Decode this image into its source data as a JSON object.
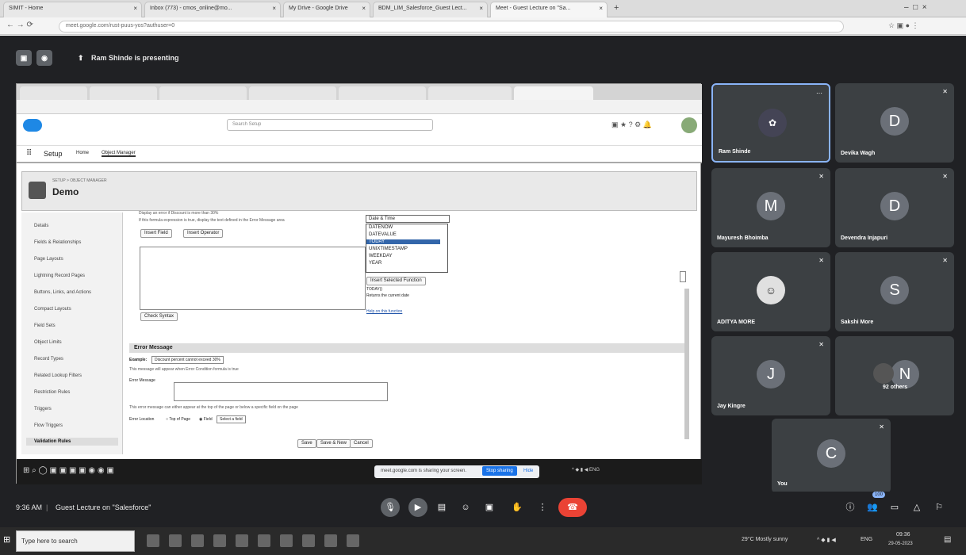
{
  "browser": {
    "tabs": [
      {
        "label": "SIMIT - Home",
        "active": false
      },
      {
        "label": "Inbox (773) - cmos_online@mo...",
        "active": false
      },
      {
        "label": "My Drive - Google Drive",
        "active": false
      },
      {
        "label": "BDM_LIM_Salesforce_Guest Lect...",
        "active": false
      },
      {
        "label": "Meet - Guest Lecture on \"Sa...",
        "active": true
      }
    ],
    "url": "meet.google.com/rust-puus-yos?authuser=0"
  },
  "meet": {
    "presenting_text": "Ram Shinde is presenting",
    "meeting_time": "9:36 AM",
    "meeting_title": "Guest Lecture on \"Salesforce\"",
    "participants": [
      {
        "name": "Ram Shinde",
        "initial": "",
        "color": "#5f6368"
      },
      {
        "name": "Devika Wagh",
        "initial": "D",
        "color": "#6b7078"
      },
      {
        "name": "Mayuresh Bhoimba",
        "initial": "M",
        "color": "#6b7078"
      },
      {
        "name": "Devendra Injapuri",
        "initial": "D",
        "color": "#6b7078"
      },
      {
        "name": "ADITYA MORE",
        "initial": "",
        "color": "#5f6368"
      },
      {
        "name": "Sakshi More",
        "initial": "S",
        "color": "#6b7078"
      },
      {
        "name": "Jay Kingre",
        "initial": "J",
        "color": "#6b7078"
      },
      {
        "name": "92 others",
        "initial": "N",
        "color": "#6b7078"
      },
      {
        "name": "You",
        "initial": "C",
        "color": "#6b7078"
      }
    ],
    "people_badge": "100"
  },
  "shared": {
    "sf_search": "Search Setup",
    "setup_label": "Setup",
    "home_label": "Home",
    "object_manager_label": "Object Manager",
    "breadcrumb": "SETUP > OBJECT MANAGER",
    "object_name": "Demo",
    "left_nav": [
      "Details",
      "Fields & Relationships",
      "Page Layouts",
      "Lightning Record Pages",
      "Buttons, Links, and Actions",
      "Compact Layouts",
      "Field Sets",
      "Object Limits",
      "Record Types",
      "Related Lookup Filters",
      "Restriction Rules",
      "Triggers",
      "Flow Triggers",
      "Validation Rules"
    ],
    "formula_hint1": "Display an error if Discount is more than 30%",
    "formula_hint2": "If this formula expression is true, display the text defined in the Error Message area",
    "insert_field": "Insert Field",
    "insert_operator": "Insert Operator",
    "function_category": "Date & Time",
    "functions": [
      "DATENOW",
      "DATEVALUE",
      "TODAY",
      "UNIXTIMESTAMP",
      "WEEKDAY",
      "YEAR"
    ],
    "insert_function": "Insert Selected Function",
    "func_sig": "TODAY()",
    "func_desc": "Returns the current date",
    "func_help": "Help on this function",
    "check_syntax": "Check Syntax",
    "error_heading": "Error Message",
    "example_label": "Example:",
    "example_text": "Discount percent cannot exceed 30%",
    "error_hint": "This message will appear when Error Condition formula is true",
    "error_message_label": "Error Message",
    "location_hint": "This error message can either appear at the top of the page or below a specific field on the page",
    "error_location_label": "Error Location",
    "top_of_page": "Top of Page",
    "field_label": "Field",
    "field_select": "Select a field",
    "save": "Save",
    "save_new": "Save & New",
    "cancel": "Cancel",
    "share_msg": "meet.google.com is sharing your screen.",
    "stop_sharing": "Stop sharing",
    "hide": "Hide"
  },
  "taskbar": {
    "search_placeholder": "Type here to search",
    "weather": "29°C  Mostly sunny",
    "lang": "ENG",
    "clock_time": "09:36",
    "clock_date": "29-05-2023"
  }
}
